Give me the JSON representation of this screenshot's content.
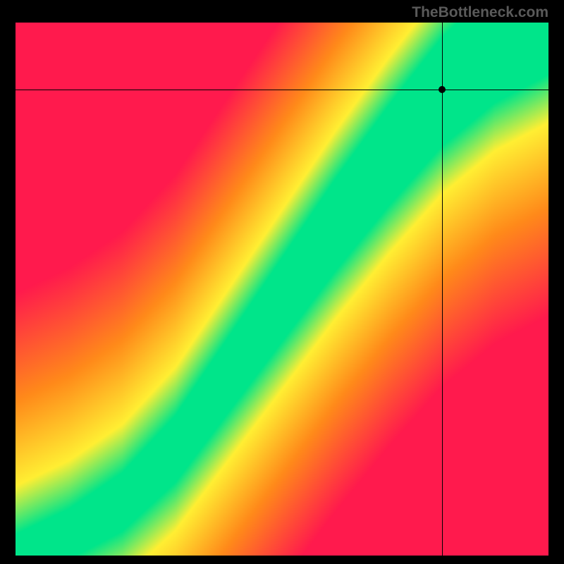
{
  "watermark": "TheBottleneck.com",
  "chart_data": {
    "type": "heatmap",
    "title": "",
    "xlabel": "",
    "ylabel": "",
    "xlim": [
      0,
      1
    ],
    "ylim": [
      0,
      1
    ],
    "grid": false,
    "legend": false,
    "marker": {
      "x": 0.8,
      "y": 0.875
    },
    "ridge": [
      {
        "x": 0.0,
        "y": 0.0
      },
      {
        "x": 0.1,
        "y": 0.04
      },
      {
        "x": 0.2,
        "y": 0.1
      },
      {
        "x": 0.3,
        "y": 0.2
      },
      {
        "x": 0.4,
        "y": 0.34
      },
      {
        "x": 0.5,
        "y": 0.48
      },
      {
        "x": 0.6,
        "y": 0.62
      },
      {
        "x": 0.7,
        "y": 0.75
      },
      {
        "x": 0.8,
        "y": 0.87
      },
      {
        "x": 0.9,
        "y": 0.96
      },
      {
        "x": 1.0,
        "y": 1.02
      }
    ],
    "band_halfwidth": 0.065,
    "colors": {
      "low": "#ff1a4d",
      "mid": "#ffef33",
      "high": "#00e58a"
    }
  }
}
